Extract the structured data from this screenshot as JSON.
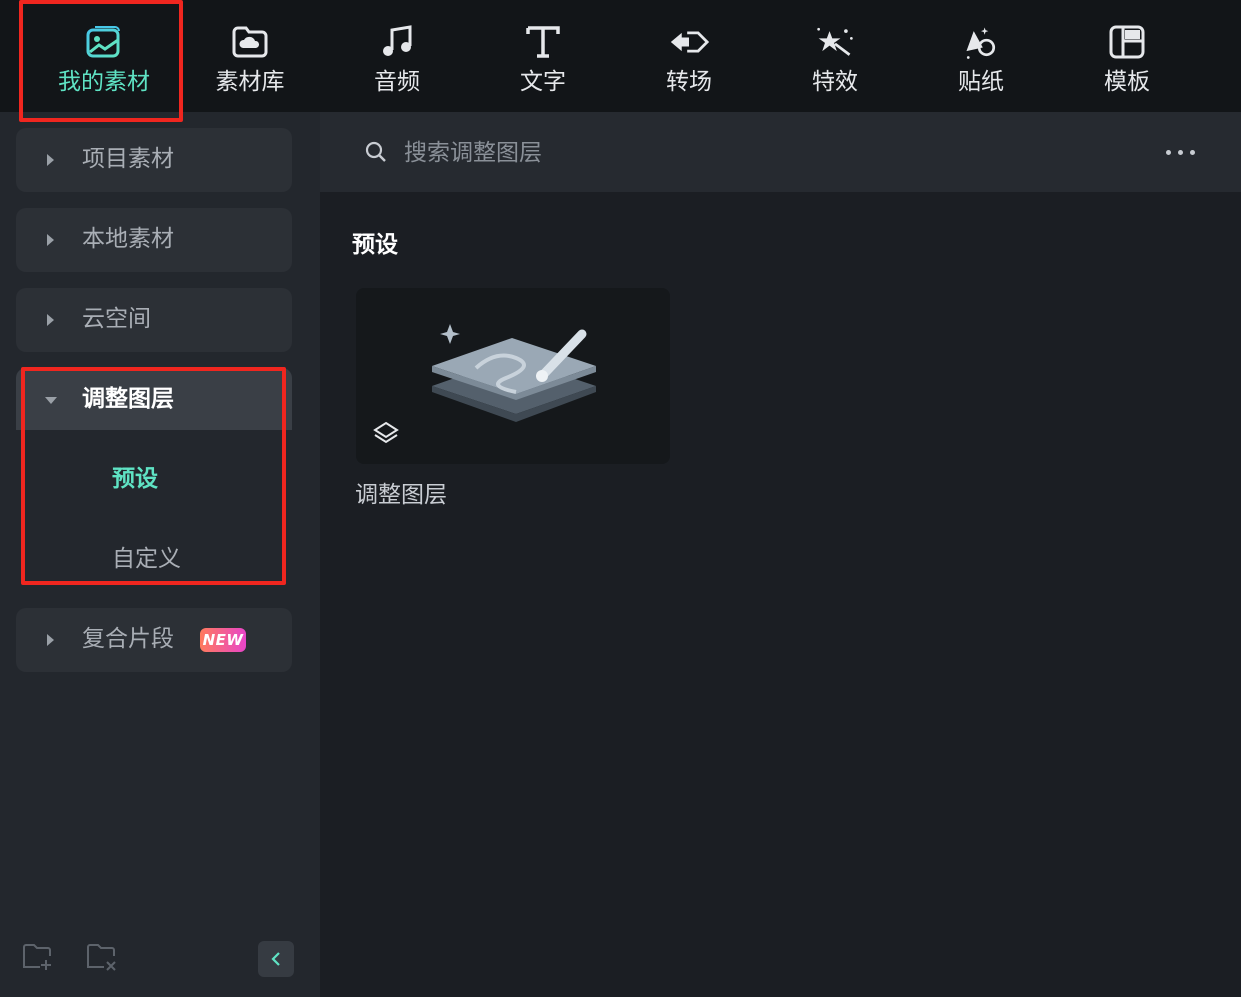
{
  "toolbar": {
    "tabs": [
      {
        "label": "我的素材",
        "icon": "my-media-icon",
        "active": true
      },
      {
        "label": "素材库",
        "icon": "stock-library-cloud-icon",
        "active": false
      },
      {
        "label": "音频",
        "icon": "music-note-icon",
        "active": false
      },
      {
        "label": "文字",
        "icon": "text-t-icon",
        "active": false
      },
      {
        "label": "转场",
        "icon": "transition-icon",
        "active": false
      },
      {
        "label": "特效",
        "icon": "effects-star-icon",
        "active": false
      },
      {
        "label": "贴纸",
        "icon": "sticker-icon",
        "active": false
      },
      {
        "label": "模板",
        "icon": "template-icon",
        "active": false
      }
    ],
    "active_color": "#5fe3c4"
  },
  "sidebar": {
    "items": [
      {
        "label": "项目素材",
        "expanded": false
      },
      {
        "label": "本地素材",
        "expanded": false
      },
      {
        "label": "云空间",
        "expanded": false
      },
      {
        "label": "调整图层",
        "expanded": true,
        "children": [
          {
            "label": "预设",
            "selected": true
          },
          {
            "label": "自定义",
            "selected": false
          }
        ]
      },
      {
        "label": "复合片段",
        "expanded": false,
        "badge": "NEW"
      }
    ]
  },
  "search": {
    "placeholder": "搜索调整图层"
  },
  "main": {
    "section_title": "预设",
    "cards": [
      {
        "label": "调整图层",
        "icon": "adjustment-layer-icon"
      }
    ]
  },
  "annotation_color": "#f0261f"
}
